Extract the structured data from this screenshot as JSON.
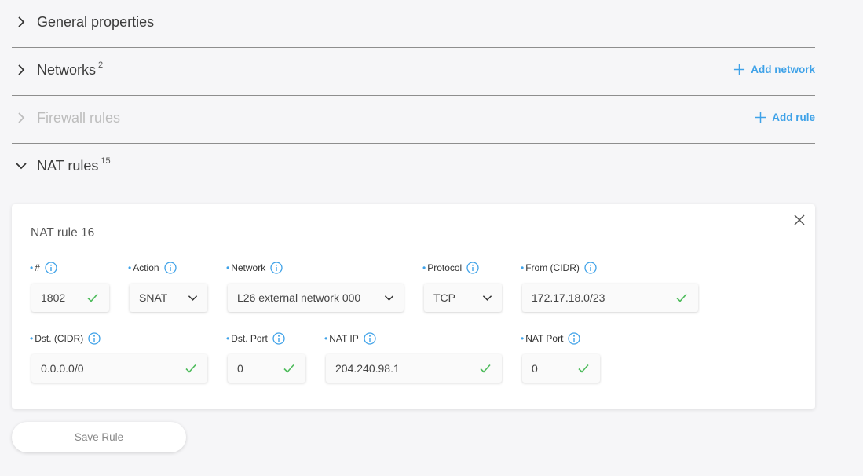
{
  "sections": {
    "general": {
      "title": "General properties"
    },
    "networks": {
      "title": "Networks",
      "count": "2",
      "add_label": "Add network"
    },
    "firewall": {
      "title": "Firewall rules",
      "add_label": "Add rule"
    },
    "nat": {
      "title": "NAT rules",
      "count": "15"
    }
  },
  "nat_form": {
    "title": "NAT rule 16",
    "fields": {
      "number": {
        "label": "#",
        "value": "1802"
      },
      "action": {
        "label": "Action",
        "value": "SNAT"
      },
      "network": {
        "label": "Network",
        "value": "L26 external network 000"
      },
      "protocol": {
        "label": "Protocol",
        "value": "TCP"
      },
      "from_cidr": {
        "label": "From (CIDR)",
        "value": "172.17.18.0/23"
      },
      "dst_cidr": {
        "label": "Dst. (CIDR)",
        "value": "0.0.0.0/0"
      },
      "dst_port": {
        "label": "Dst. Port",
        "value": "0"
      },
      "nat_ip": {
        "label": "NAT IP",
        "value": "204.240.98.1"
      },
      "nat_port": {
        "label": "NAT Port",
        "value": "0"
      }
    },
    "save_label": "Save Rule"
  },
  "colors": {
    "accent": "#3fa2e8",
    "check": "#4cbb5a",
    "divider": "#8e8e8e",
    "background": "#f6f6f8"
  }
}
